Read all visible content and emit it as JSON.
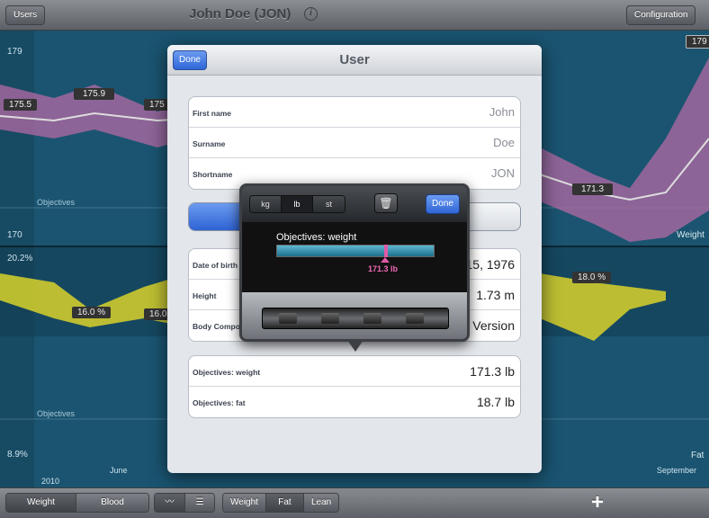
{
  "toolbar": {
    "users_label": "Users",
    "title": "John Doe (JON)",
    "info_glyph": "i",
    "config_label": "Configuration"
  },
  "chart": {
    "y_labels": [
      "179",
      "170",
      "20.2%",
      "8.9%"
    ],
    "objectives_label": "Objectives",
    "weight_label": "Weight",
    "fat_label": "Fat",
    "year_label": "2010",
    "month_labels": [
      "June",
      "September"
    ],
    "weight_points": [
      "175.5",
      "175.9",
      "175",
      "171.3"
    ],
    "top_right_value": "179",
    "fat_points": [
      "16.0 %",
      "16.0",
      "18.0 %"
    ]
  },
  "modal": {
    "title": "User",
    "done_label": "Done",
    "group1": [
      {
        "label": "First name",
        "value": "John"
      },
      {
        "label": "Surname",
        "value": "Doe"
      },
      {
        "label": "Shortname",
        "value": "JON"
      }
    ],
    "group2": [
      {
        "label": "Date of birth",
        "value": "15, 1976"
      },
      {
        "label": "Height",
        "value": "1.73 m"
      },
      {
        "label": "Body Compo",
        "value": "Version"
      }
    ],
    "group3": [
      {
        "label": "Objectives: weight",
        "value": "171.3 lb"
      },
      {
        "label": "Objectives: fat",
        "value": "18.7 lb"
      }
    ]
  },
  "popover": {
    "units": [
      "kg",
      "lb",
      "st"
    ],
    "selected_unit": "lb",
    "trash_glyph": "🗑",
    "done_label": "Done",
    "label": "Objectives: weight",
    "value": "171.3 lb",
    "position_fraction": 0.68
  },
  "bottombar": {
    "view_seg": [
      "Weight",
      "Blood pressure"
    ],
    "mode_seg": [
      "Weight",
      "Fat",
      "Lean"
    ],
    "plus_label": "+"
  }
}
